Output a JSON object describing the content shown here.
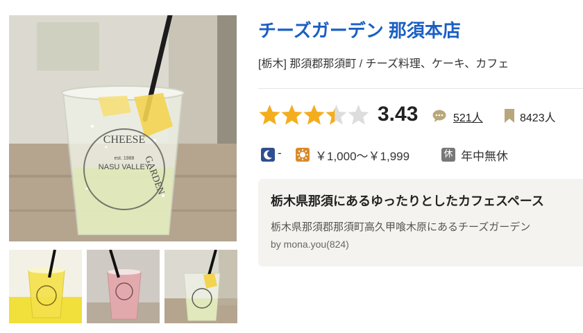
{
  "restaurant": {
    "name": "チーズガーデン 那須本店",
    "genre_line": "[栃木] 那須郡那須町 / チーズ料理、ケーキ、カフェ"
  },
  "rating": {
    "score": "3.43",
    "value": 3.43,
    "max": 5,
    "star_color": "#f4ad1c",
    "star_empty_color": "#dddddd",
    "review_count": "521人",
    "bookmark_count": "8423人"
  },
  "budget": {
    "dinner_icon": "moon-icon",
    "dinner": "-",
    "lunch_icon": "sun-icon",
    "lunch": "￥1,000～￥1,999",
    "holiday_label": "休",
    "holiday": "年中無休"
  },
  "featured_review": {
    "title": "栃木県那須にあるゆったりとしたカフェスペース",
    "body": "栃木県那須郡那須町高久甲喰木原にあるチーズガーデン",
    "author": "by mona.you(824)"
  },
  "photos": {
    "main_cup_logo_top": "CHEESE",
    "main_cup_logo_side": "GARDEN",
    "main_cup_logo_middle": "NASU VALLEY",
    "main_cup_logo_since": "est. 1988",
    "thumb_count": 3
  },
  "colors": {
    "title_link": "#1a5fc4",
    "review_box_bg": "#f5f3ef"
  }
}
